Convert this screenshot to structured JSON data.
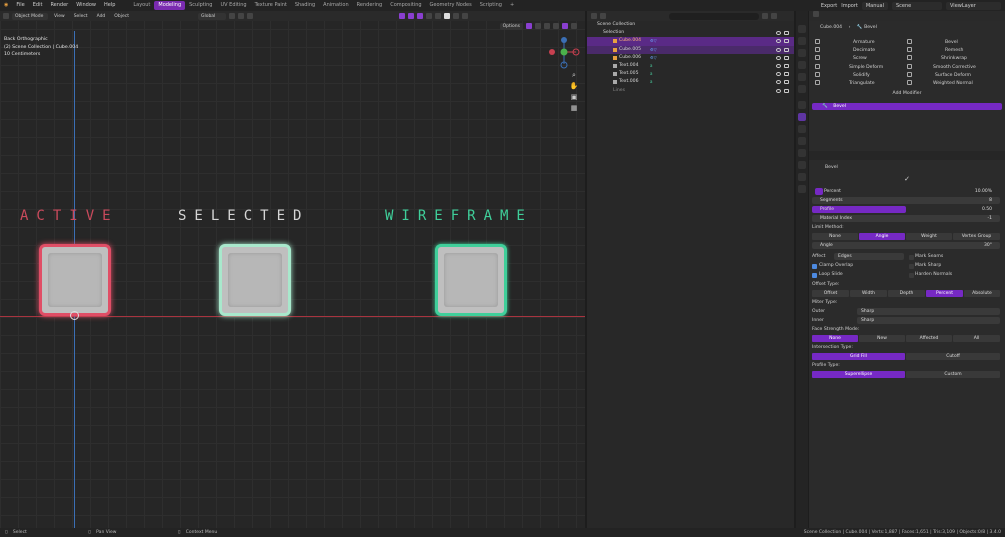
{
  "topbar": {
    "menus": [
      "File",
      "Edit",
      "Render",
      "Window",
      "Help"
    ],
    "workspaces": [
      "Layout",
      "Modeling",
      "Sculpting",
      "UV Editing",
      "Texture Paint",
      "Shading",
      "Animation",
      "Rendering",
      "Compositing",
      "Geometry Nodes",
      "Scripting"
    ],
    "active_workspace": "Modeling",
    "add_tab": "+",
    "export": "Export",
    "import": "Import",
    "manual": "Manual",
    "scene": "Scene",
    "view_layer": "ViewLayer"
  },
  "viewport": {
    "mode": "Object Mode",
    "menus": [
      "View",
      "Select",
      "Add",
      "Object"
    ],
    "orientation": "Global",
    "options": "Options",
    "info_lines": [
      "Back Orthographic",
      "(2) Scene Collection | Cube.004",
      "10 Centimeters"
    ],
    "labels": {
      "active": "ACTIVE",
      "selected": "SELECTED",
      "wireframe": "WIREFRAME"
    },
    "colors": {
      "active": "#e04e66",
      "selected": "#a8e8cc",
      "wireframe": "#3fcf9a",
      "accent": "#7a2bb0"
    }
  },
  "outliner": {
    "root": "Scene Collection",
    "collection": "Selection",
    "items": [
      {
        "name": "Cube.004",
        "state": "active"
      },
      {
        "name": "Cube.005",
        "state": "selected"
      },
      {
        "name": "Cube.006",
        "state": "normal"
      },
      {
        "name": "Text.004",
        "state": "normal"
      },
      {
        "name": "Text.005",
        "state": "normal"
      },
      {
        "name": "Text.006",
        "state": "normal"
      }
    ],
    "lines_collection": "Lines"
  },
  "properties": {
    "breadcrumb_object": "Cube.004",
    "breadcrumb_modifier": "Bevel",
    "modifier_menu_left": [
      "Armature",
      "Decimate",
      "Screw",
      "Simple Deform",
      "Solidify",
      "Triangulate"
    ],
    "modifier_menu_right": [
      "Bevel",
      "Remesh",
      "Shrinkwrap",
      "Smooth Corrective",
      "Surface Deform",
      "Weighted Normal"
    ],
    "add_modifier": "Add Modifier",
    "modifier_name": "Bevel",
    "panel_name": "Bevel",
    "width_type": "Percent",
    "width_value": "10.00%",
    "segments_label": "Segments",
    "segments_value": "8",
    "profile_label": "Profile",
    "profile_value": "0.50",
    "material_label": "Material Index",
    "material_value": "-1",
    "limit_method_label": "Limit Method:",
    "limit_methods": [
      "None",
      "Angle",
      "Weight",
      "Vertex Group"
    ],
    "limit_method_active": "Angle",
    "angle_label": "Angle",
    "angle_value": "30°",
    "affect_label": "Affect",
    "affect_value": "Edges",
    "clamp_overlap": "Clamp Overlap",
    "loop_slide": "Loop Slide",
    "mark_seams": "Mark Seams",
    "mark_sharp": "Mark Sharp",
    "harden_normals": "Harden Normals",
    "offset_type_label": "Offset Type:",
    "offset_types": [
      "Offset",
      "Width",
      "Depth",
      "Percent",
      "Absolute"
    ],
    "offset_type_active": "Percent",
    "miter_type_label": "Miter Type:",
    "outer_label": "Outer",
    "outer_value": "Sharp",
    "inner_label": "Inner",
    "inner_value": "Sharp",
    "face_strength_label": "Face Strength Mode:",
    "face_strength": [
      "None",
      "New",
      "Affected",
      "All"
    ],
    "face_strength_active": "None",
    "intersection_label": "Intersection Type:",
    "intersection": [
      "Grid Fill",
      "Cutoff"
    ],
    "intersection_active": "Grid Fill",
    "profile_type_label": "Profile Type:",
    "profile_types": [
      "Superellipse",
      "Custom"
    ],
    "profile_type_active": "Superellipse"
  },
  "statusbar": {
    "select": "Select",
    "pan": "Pan View",
    "context": "Context Menu",
    "stats": "Scene Collection | Cube.004 | Verts:1,887 | Faces:1,651 | Tris:3,109 | Objects:0/8 | 3.4.0"
  }
}
